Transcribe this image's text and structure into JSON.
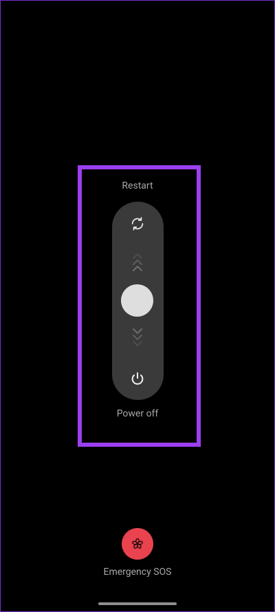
{
  "power_menu": {
    "restart_label": "Restart",
    "poweroff_label": "Power off",
    "icons": {
      "restart": "restart-icon",
      "power": "power-icon",
      "slide_up": "chevron-up-icon",
      "slide_down": "chevron-down-icon"
    }
  },
  "emergency": {
    "label": "Emergency SOS",
    "icon": "asterisk-icon",
    "color": "#e8434f"
  },
  "colors": {
    "background": "#000000",
    "highlight": "#9b3ff0",
    "track": "#3a3a3a",
    "knob": "#dedede",
    "label": "#a7a7a7"
  }
}
